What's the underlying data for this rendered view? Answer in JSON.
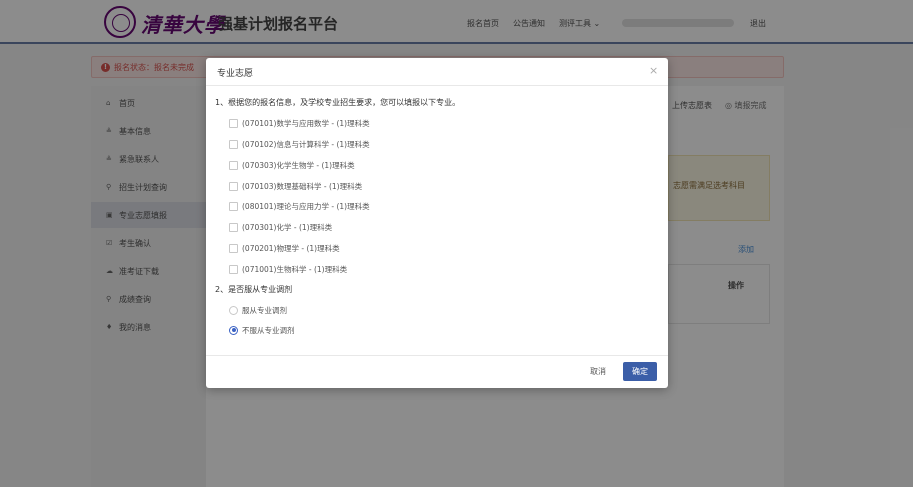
{
  "header": {
    "logo_text": "清華大學",
    "platform_title": "强基计划报名平台",
    "nav": [
      "报名首页",
      "公告通知",
      "测评工具 ⌄"
    ],
    "logout": "退出"
  },
  "status": {
    "icon": "!",
    "text": "报名状态：报名未完成"
  },
  "sidebar": {
    "items": [
      {
        "icon": "home-icon",
        "glyph": "⌂",
        "label": "首页"
      },
      {
        "icon": "user-icon",
        "glyph": "≗",
        "label": "基本信息"
      },
      {
        "icon": "contact-icon",
        "glyph": "≗",
        "label": "紧急联系人"
      },
      {
        "icon": "search-icon",
        "glyph": "⚲",
        "label": "招生计划查询"
      },
      {
        "icon": "form-icon",
        "glyph": "▣",
        "label": "专业志愿填报"
      },
      {
        "icon": "confirm-icon",
        "glyph": "☑",
        "label": "考生确认"
      },
      {
        "icon": "cloud-download-icon",
        "glyph": "☁",
        "label": "准考证下载"
      },
      {
        "icon": "search-icon",
        "glyph": "⚲",
        "label": "成绩查询"
      },
      {
        "icon": "bell-icon",
        "glyph": "♦",
        "label": "我的消息"
      }
    ],
    "active_index": 4
  },
  "background": {
    "upload": "上传志愿表",
    "fill_done": "◎ 填报完成",
    "note": "志愿需满足选考科目",
    "add": "添加",
    "operation": "操作"
  },
  "modal": {
    "title": "专业志愿",
    "close": "×",
    "q1": "1、根据您的报名信息，及学校专业招生要求，您可以填报以下专业。",
    "majors": [
      "(070101)数学与应用数学 - (1)理科类",
      "(070102)信息与计算科学 - (1)理科类",
      "(070303)化学生物学 - (1)理科类",
      "(070103)数理基础科学 - (1)理科类",
      "(080101)理论与应用力学 - (1)理科类",
      "(070301)化学 - (1)理科类",
      "(070201)物理学 - (1)理科类",
      "(071001)生物科学 - (1)理科类"
    ],
    "q2": "2、是否服从专业调剂",
    "adjust_options": [
      "服从专业调剂",
      "不服从专业调剂"
    ],
    "adjust_selected": 1,
    "cancel": "取消",
    "confirm": "确定"
  },
  "colors": {
    "brand_purple": "#660874",
    "primary_blue": "#3b5ea8",
    "status_red": "#d9534f"
  }
}
